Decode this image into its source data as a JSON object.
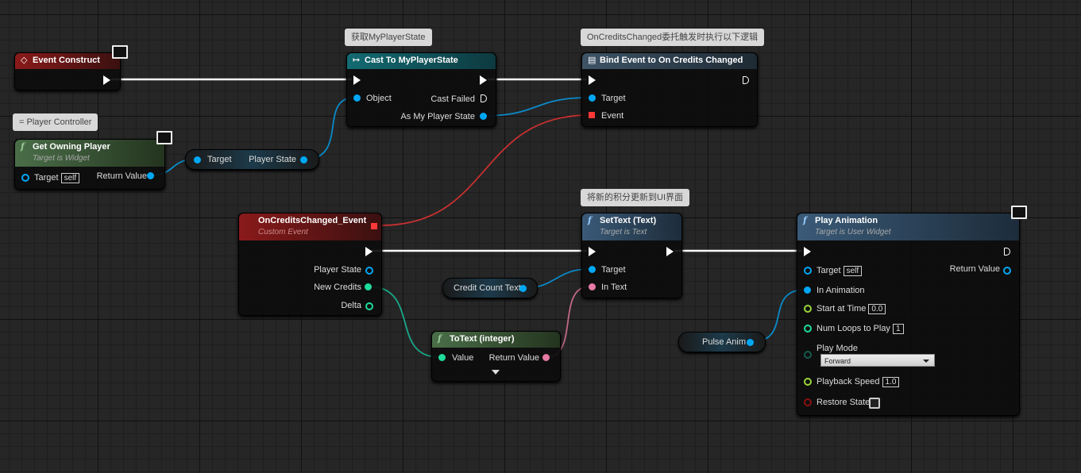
{
  "comments": {
    "cast": "获取MyPlayerState",
    "bind": "OnCreditsChanged委托触发时执行以下逻辑",
    "controller": "= Player Controller",
    "settext": "将新的积分更新到UI界面"
  },
  "event_construct": {
    "title": "Event Construct"
  },
  "cast": {
    "title": "Cast To MyPlayerState",
    "object": "Object",
    "cast_failed": "Cast Failed",
    "as": "As My Player State"
  },
  "bind": {
    "title": "Bind Event to On Credits Changed",
    "target": "Target",
    "event": "Event"
  },
  "get_owning_player": {
    "title": "Get Owning Player",
    "subtitle": "Target is Widget",
    "target": "Target",
    "self": "self",
    "return": "Return Value"
  },
  "player_state_getter": {
    "target": "Target",
    "output": "Player State"
  },
  "credits_event": {
    "title": "OnCreditsChanged_Event",
    "subtitle": "Custom Event",
    "pins": [
      "Player State",
      "New Credits",
      "Delta"
    ]
  },
  "settext": {
    "title": "SetText (Text)",
    "subtitle": "Target is Text",
    "target": "Target",
    "in_text": "In Text"
  },
  "credit_count_text": {
    "label": "Credit Count Text"
  },
  "totext": {
    "title": "ToText (integer)",
    "value": "Value",
    "return": "Return Value"
  },
  "pulse_anim": {
    "label": "Pulse Anim"
  },
  "play_animation": {
    "title": "Play Animation",
    "subtitle": "Target is User Widget",
    "target": "Target",
    "self": "self",
    "return": "Return Value",
    "in_animation": "In Animation",
    "start_at_time": "Start at Time",
    "start_value": "0.0",
    "num_loops": "Num Loops to Play",
    "loops_value": "1",
    "play_mode": "Play Mode",
    "play_mode_value": "Forward",
    "playback_speed": "Playback Speed",
    "speed_value": "1.0",
    "restore_state": "Restore State",
    "restore_checked": false
  },
  "colors": {
    "exec": "#ffffff",
    "object": "#00a8f4",
    "int": "#1edc9a",
    "text": "#e47aa5",
    "delegate": "#ff3838",
    "float": "#9ad63a",
    "event_header": "#8a1a1a",
    "pure_header": "#4a6e48",
    "cast_header": "#136a72",
    "func_header": "#3a5a78"
  }
}
